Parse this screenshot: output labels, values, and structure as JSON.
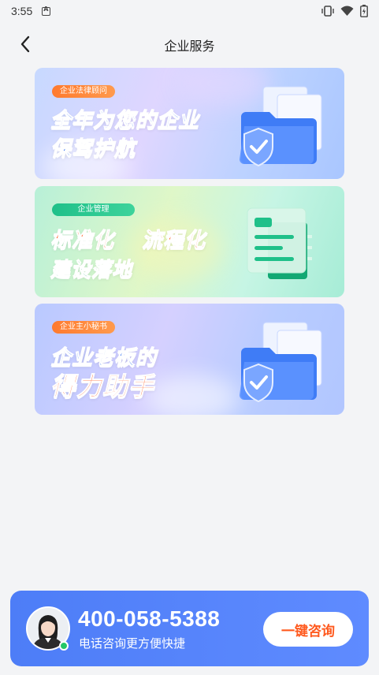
{
  "status_bar": {
    "time": "3:55",
    "icons": [
      "vibrate-icon",
      "wifi-icon",
      "battery-icon"
    ]
  },
  "header": {
    "title": "企业服务",
    "back_icon": "chevron-left-icon"
  },
  "banners": [
    {
      "tag": "企业法律顾问",
      "line1": "全年为您的企业",
      "line2": "保驾护航",
      "art_icon": "folder-shield-icon"
    },
    {
      "tag": "企业管理",
      "line1a": "标准化",
      "line1b": "流程化",
      "line2": "建设落地",
      "art_icon": "document-list-icon"
    },
    {
      "tag": "企业主小秘书",
      "line1": "企业老板的",
      "line2": "得力助手",
      "art_icon": "folder-shield-icon"
    }
  ],
  "contact": {
    "phone": "400-058-5388",
    "subtitle": "电话咨询更方便快捷",
    "button_label": "一键咨询",
    "avatar_icon": "consultant-avatar",
    "status": "online"
  },
  "colors": {
    "accent_blue": "#4d7df7",
    "orange": "#ff5a1f",
    "green": "#1fc089",
    "headline_blue": "#1d63f0"
  }
}
